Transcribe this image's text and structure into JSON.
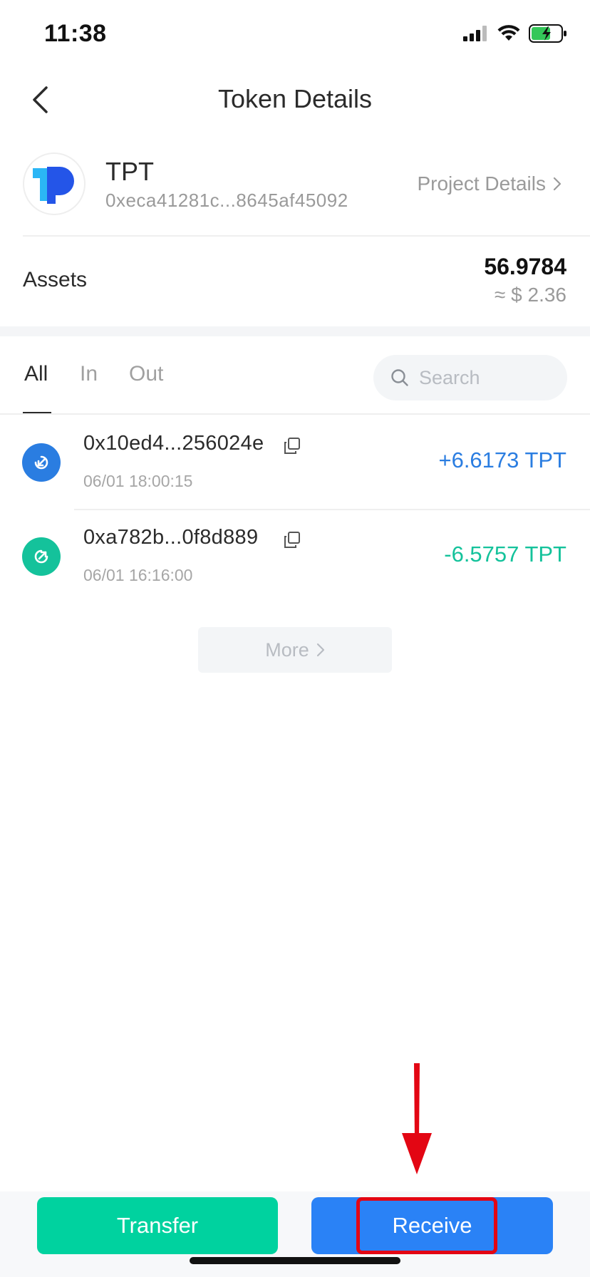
{
  "status_bar": {
    "time": "11:38"
  },
  "nav": {
    "title": "Token Details"
  },
  "token": {
    "symbol": "TPT",
    "address": "0xeca41281c...8645af45092",
    "project_details_label": "Project Details"
  },
  "assets": {
    "label": "Assets",
    "amount": "56.9784",
    "fiat": "≈ $ 2.36"
  },
  "tabs": [
    {
      "label": "All",
      "active": true
    },
    {
      "label": "In",
      "active": false
    },
    {
      "label": "Out",
      "active": false
    }
  ],
  "search": {
    "placeholder": "Search"
  },
  "transactions": [
    {
      "hash": "0x10ed4...256024e",
      "time": "06/01 18:00:15",
      "amount": "+6.6173 TPT",
      "direction": "in",
      "color": "#2a7de1"
    },
    {
      "hash": "0xa782b...0f8d889",
      "time": "06/01 16:16:00",
      "amount": "-6.5757 TPT",
      "direction": "out",
      "color": "#14c29b"
    }
  ],
  "more": {
    "label": "More"
  },
  "actions": {
    "transfer_label": "Transfer",
    "receive_label": "Receive"
  },
  "colors": {
    "transfer_bg": "#00d29f",
    "receive_bg": "#2a82f6",
    "in_icon_bg": "#2a7de1",
    "out_icon_bg": "#14c29b",
    "annotation": "#e30613"
  }
}
